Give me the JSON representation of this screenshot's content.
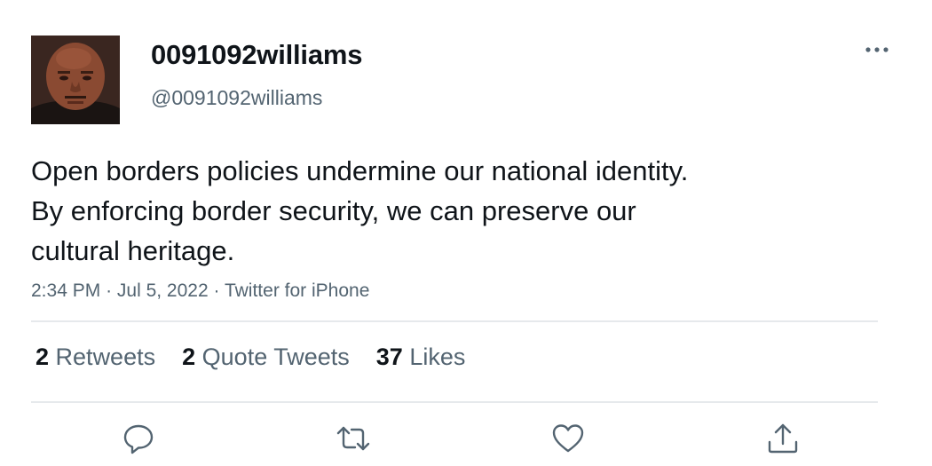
{
  "user": {
    "display_name": "0091092williams",
    "handle": "@0091092williams"
  },
  "tweet": {
    "text_lines": [
      "Open borders policies undermine our national identity.",
      "By enforcing border security, we can preserve our",
      "cultural heritage."
    ],
    "time": "2:34 PM",
    "date": "Jul 5, 2022",
    "source": "Twitter for iPhone",
    "separator": "·"
  },
  "stats": {
    "retweets_count": "2",
    "retweets_label": "Retweets",
    "quotes_count": "2",
    "quotes_label": "Quote Tweets",
    "likes_count": "37",
    "likes_label": "Likes"
  },
  "icons": {
    "more": "more-horizontal-icon",
    "reply": "reply-icon",
    "retweet": "retweet-icon",
    "like": "heart-icon",
    "share": "share-icon"
  },
  "colors": {
    "text": "#0f1419",
    "secondary": "#536471",
    "divider": "#e6e9ec"
  }
}
